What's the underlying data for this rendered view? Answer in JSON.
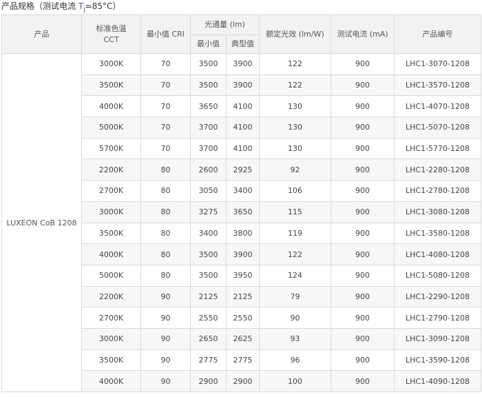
{
  "title": {
    "prefix": "产品规格（测试电流 ",
    "tj_t": "T",
    "tj_sub": "j",
    "suffix": "=85°C）"
  },
  "headers": {
    "product": "产品",
    "cct_line1": "标准色温",
    "cct_line2": "CCT",
    "cri": "最小值 CRI",
    "flux": "光通量 (lm)",
    "flux_min": "最小值",
    "flux_typ": "典型值",
    "efficacy": "额定光效 (lm/W)",
    "current": "测试电流 (mA)",
    "part": "产品编号"
  },
  "product_name": "LUXEON CoB 1208",
  "rows": [
    {
      "cct": "3000K",
      "cri": "70",
      "min": "3500",
      "typ": "3900",
      "eff": "122",
      "cur": "900",
      "part": "LHC1-3070-1208"
    },
    {
      "cct": "3500K",
      "cri": "70",
      "min": "3500",
      "typ": "3900",
      "eff": "122",
      "cur": "900",
      "part": "LHC1-3570-1208"
    },
    {
      "cct": "4000K",
      "cri": "70",
      "min": "3650",
      "typ": "4100",
      "eff": "130",
      "cur": "900",
      "part": "LHC1-4070-1208"
    },
    {
      "cct": "5000K",
      "cri": "70",
      "min": "3700",
      "typ": "4100",
      "eff": "130",
      "cur": "900",
      "part": "LHC1-5070-1208"
    },
    {
      "cct": "5700K",
      "cri": "70",
      "min": "3700",
      "typ": "4100",
      "eff": "130",
      "cur": "900",
      "part": "LHC1-5770-1208"
    },
    {
      "cct": "2200K",
      "cri": "80",
      "min": "2600",
      "typ": "2925",
      "eff": "92",
      "cur": "900",
      "part": "LHC1-2280-1208"
    },
    {
      "cct": "2700K",
      "cri": "80",
      "min": "3050",
      "typ": "3400",
      "eff": "106",
      "cur": "900",
      "part": "LHC1-2780-1208"
    },
    {
      "cct": "3000K",
      "cri": "80",
      "min": "3275",
      "typ": "3650",
      "eff": "115",
      "cur": "900",
      "part": "LHC1-3080-1208"
    },
    {
      "cct": "3500K",
      "cri": "80",
      "min": "3400",
      "typ": "3800",
      "eff": "119",
      "cur": "900",
      "part": "LHC1-3580-1208"
    },
    {
      "cct": "4000K",
      "cri": "80",
      "min": "3500",
      "typ": "3900",
      "eff": "122",
      "cur": "900",
      "part": "LHC1-4080-1208"
    },
    {
      "cct": "5000K",
      "cri": "80",
      "min": "3500",
      "typ": "3950",
      "eff": "124",
      "cur": "900",
      "part": "LHC1-5080-1208"
    },
    {
      "cct": "2200K",
      "cri": "90",
      "min": "2125",
      "typ": "2125",
      "eff": "79",
      "cur": "900",
      "part": "LHC1-2290-1208"
    },
    {
      "cct": "2700K",
      "cri": "90",
      "min": "2550",
      "typ": "2550",
      "eff": "90",
      "cur": "900",
      "part": "LHC1-2790-1208"
    },
    {
      "cct": "3000K",
      "cri": "90",
      "min": "2650",
      "typ": "2625",
      "eff": "93",
      "cur": "900",
      "part": "LHC1-3090-1208"
    },
    {
      "cct": "3500K",
      "cri": "90",
      "min": "2775",
      "typ": "2775",
      "eff": "96",
      "cur": "900",
      "part": "LHC1-3590-1208"
    },
    {
      "cct": "4000K",
      "cri": "90",
      "min": "2900",
      "typ": "2900",
      "eff": "100",
      "cur": "900",
      "part": "LHC1-4090-1208"
    }
  ]
}
